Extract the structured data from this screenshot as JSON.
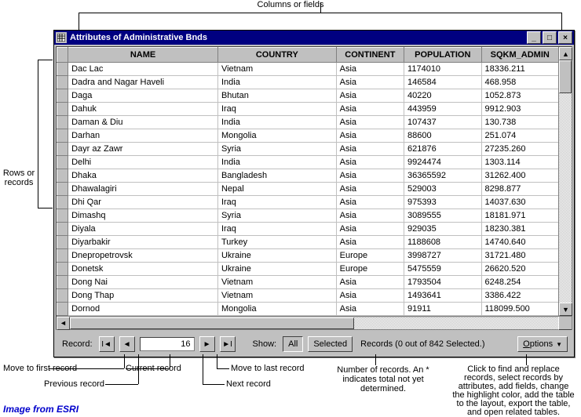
{
  "annotations": {
    "columns_label": "Columns or fields",
    "rows_label": "Rows or records",
    "move_first": "Move to first record",
    "previous": "Previous record",
    "current": "Current record",
    "next": "Next record",
    "move_last": "Move to last record",
    "records_note": "Number of records. An * indicates total not yet determined.",
    "options_note": "Click to find and replace records, select records by attributes, add fields, change the highlight color, add the table to the layout, export the table, and open related tables.",
    "credit": "Image from ESRI"
  },
  "window": {
    "title": "Attributes of Administrative Bnds"
  },
  "headers": [
    "NAME",
    "COUNTRY",
    "CONTINENT",
    "POPULATION",
    "SQKM_ADMIN"
  ],
  "rows": [
    {
      "name": "Dac Lac",
      "country": "Vietnam",
      "continent": "Asia",
      "population": "1174010",
      "sqkm": "18336.211"
    },
    {
      "name": "Dadra and Nagar Haveli",
      "country": "India",
      "continent": "Asia",
      "population": "146584",
      "sqkm": "468.958"
    },
    {
      "name": "Daga",
      "country": "Bhutan",
      "continent": "Asia",
      "population": "40220",
      "sqkm": "1052.873"
    },
    {
      "name": "Dahuk",
      "country": "Iraq",
      "continent": "Asia",
      "population": "443959",
      "sqkm": "9912.903"
    },
    {
      "name": "Daman & Diu",
      "country": "India",
      "continent": "Asia",
      "population": "107437",
      "sqkm": "130.738"
    },
    {
      "name": "Darhan",
      "country": "Mongolia",
      "continent": "Asia",
      "population": "88600",
      "sqkm": "251.074"
    },
    {
      "name": "Dayr az Zawr",
      "country": "Syria",
      "continent": "Asia",
      "population": "621876",
      "sqkm": "27235.260"
    },
    {
      "name": "Delhi",
      "country": "India",
      "continent": "Asia",
      "population": "9924474",
      "sqkm": "1303.114"
    },
    {
      "name": "Dhaka",
      "country": "Bangladesh",
      "continent": "Asia",
      "population": "36365592",
      "sqkm": "31262.400"
    },
    {
      "name": "Dhawalagiri",
      "country": "Nepal",
      "continent": "Asia",
      "population": "529003",
      "sqkm": "8298.877"
    },
    {
      "name": "Dhi Qar",
      "country": "Iraq",
      "continent": "Asia",
      "population": "975393",
      "sqkm": "14037.630"
    },
    {
      "name": "Dimashq",
      "country": "Syria",
      "continent": "Asia",
      "population": "3089555",
      "sqkm": "18181.971"
    },
    {
      "name": "Diyala",
      "country": "Iraq",
      "continent": "Asia",
      "population": "929035",
      "sqkm": "18230.381"
    },
    {
      "name": "Diyarbakir",
      "country": "Turkey",
      "continent": "Asia",
      "population": "1188608",
      "sqkm": "14740.640"
    },
    {
      "name": "Dnepropetrovsk",
      "country": "Ukraine",
      "continent": "Europe",
      "population": "3998727",
      "sqkm": "31721.480"
    },
    {
      "name": "Donetsk",
      "country": "Ukraine",
      "continent": "Europe",
      "population": "5475559",
      "sqkm": "26620.520"
    },
    {
      "name": "Dong Nai",
      "country": "Vietnam",
      "continent": "Asia",
      "population": "1793504",
      "sqkm": "6248.254"
    },
    {
      "name": "Dong Thap",
      "country": "Vietnam",
      "continent": "Asia",
      "population": "1493641",
      "sqkm": "3386.422"
    },
    {
      "name": "Dornod",
      "country": "Mongolia",
      "continent": "Asia",
      "population": "91911",
      "sqkm": "118099.500"
    }
  ],
  "chart_data": {
    "type": "table",
    "title": "Attributes of Administrative Bnds",
    "columns": [
      "NAME",
      "COUNTRY",
      "CONTINENT",
      "POPULATION",
      "SQKM_ADMIN"
    ],
    "rows": [
      [
        "Dac Lac",
        "Vietnam",
        "Asia",
        1174010,
        18336.211
      ],
      [
        "Dadra and Nagar Haveli",
        "India",
        "Asia",
        146584,
        468.958
      ],
      [
        "Daga",
        "Bhutan",
        "Asia",
        40220,
        1052.873
      ],
      [
        "Dahuk",
        "Iraq",
        "Asia",
        443959,
        9912.903
      ],
      [
        "Daman & Diu",
        "India",
        "Asia",
        107437,
        130.738
      ],
      [
        "Darhan",
        "Mongolia",
        "Asia",
        88600,
        251.074
      ],
      [
        "Dayr az Zawr",
        "Syria",
        "Asia",
        621876,
        27235.26
      ],
      [
        "Delhi",
        "India",
        "Asia",
        9924474,
        1303.114
      ],
      [
        "Dhaka",
        "Bangladesh",
        "Asia",
        36365592,
        31262.4
      ],
      [
        "Dhawalagiri",
        "Nepal",
        "Asia",
        529003,
        8298.877
      ],
      [
        "Dhi Qar",
        "Iraq",
        "Asia",
        975393,
        14037.63
      ],
      [
        "Dimashq",
        "Syria",
        "Asia",
        3089555,
        18181.971
      ],
      [
        "Diyala",
        "Iraq",
        "Asia",
        929035,
        18230.381
      ],
      [
        "Diyarbakir",
        "Turkey",
        "Asia",
        1188608,
        14740.64
      ],
      [
        "Dnepropetrovsk",
        "Ukraine",
        "Europe",
        3998727,
        31721.48
      ],
      [
        "Donetsk",
        "Ukraine",
        "Europe",
        5475559,
        26620.52
      ],
      [
        "Dong Nai",
        "Vietnam",
        "Asia",
        1793504,
        6248.254
      ],
      [
        "Dong Thap",
        "Vietnam",
        "Asia",
        1493641,
        3386.422
      ],
      [
        "Dornod",
        "Mongolia",
        "Asia",
        91911,
        118099.5
      ]
    ]
  },
  "footer": {
    "record_label": "Record:",
    "current_record": "16",
    "show_label": "Show:",
    "all_label": "All",
    "selected_label": "Selected",
    "records_status": "Records (0 out of 842 Selected.)",
    "options_label": "Options"
  }
}
